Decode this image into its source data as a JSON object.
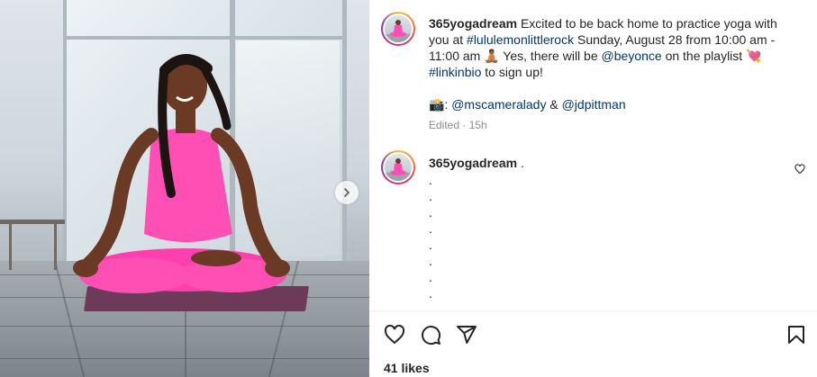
{
  "post": {
    "photo": {
      "description_icon": "photo",
      "next_icon": "chevron-right-icon"
    },
    "caption": {
      "username": "365yogadream",
      "text_1": " Excited to be back home to practice yoga with you at ",
      "tag_1": "#lululemonlittlerock",
      "text_2": " Sunday, August 28 from 10:00 am - 11:00 am ",
      "emoji_1": "🧘🏾",
      "text_3": " Yes, there will be ",
      "tag_2": "@beyonce",
      "text_4": " on the playlist ",
      "emoji_2": "💘",
      "tag_3": "#linkinbio",
      "text_5": " to sign up!"
    },
    "credit": {
      "emoji": "📸",
      "sep_1": ": ",
      "tag_1": "@mscameralady",
      "sep_2": " & ",
      "tag_2": "@jdpittman"
    },
    "edited": "Edited · 15h",
    "comment": {
      "username": "365yogadream",
      "text": " .",
      "dots": [
        ".",
        ".",
        ".",
        ".",
        ".",
        ".",
        ".",
        "."
      ]
    },
    "actions": {
      "like_icon": "heart-icon",
      "comment_icon": "comment-icon",
      "share_icon": "share-icon",
      "save_icon": "bookmark-icon"
    },
    "likes": "41 likes"
  },
  "colors": {
    "link": "#00376b",
    "muted": "#8e8e8e",
    "text": "#262626",
    "pink": "#ff4fb4"
  }
}
